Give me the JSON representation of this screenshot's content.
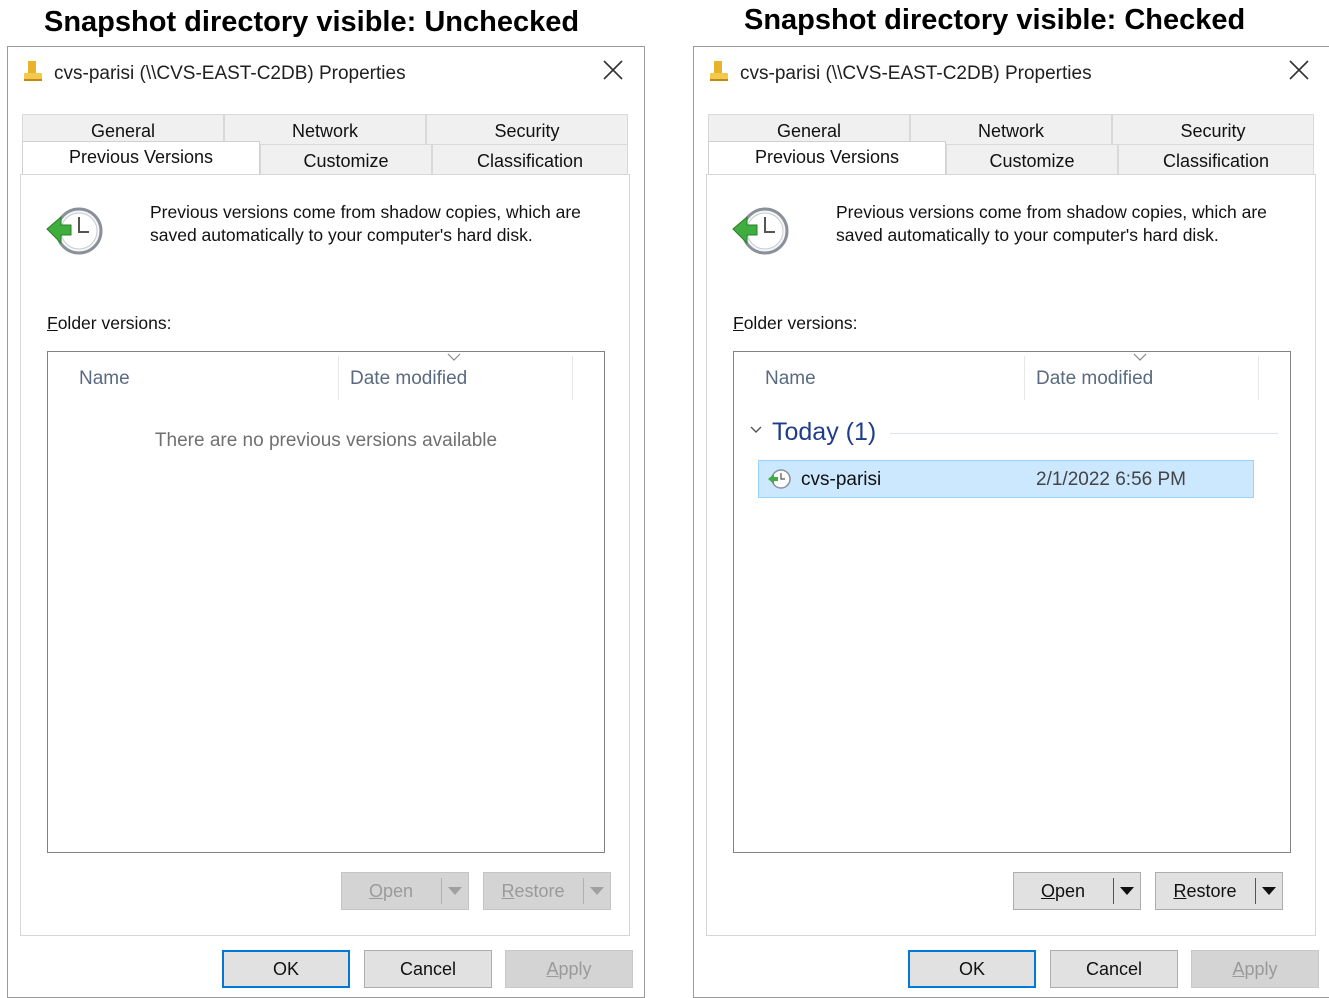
{
  "captions": {
    "left": "Snapshot directory visible: Unchecked",
    "right": "Snapshot directory visible: Checked"
  },
  "dialog": {
    "title": "cvs-parisi (\\\\CVS-EAST-C2DB) Properties",
    "tabs_row1": [
      "General",
      "Network",
      "Security"
    ],
    "tabs_row2": [
      "Previous Versions",
      "Customize",
      "Classification"
    ],
    "active_tab": "Previous Versions",
    "description_line1": "Previous versions come from shadow copies, which are",
    "description_line2": "saved automatically to your computer's hard disk.",
    "folder_versions_first": "F",
    "folder_versions_rest": "older versions:",
    "columns": {
      "name": "Name",
      "date": "Date modified"
    },
    "buttons": {
      "open_first": "O",
      "open_rest": "pen",
      "restore_first": "R",
      "restore_rest": "estore",
      "ok": "OK",
      "cancel": "Cancel",
      "apply_first": "A",
      "apply_rest": "pply"
    }
  },
  "left": {
    "empty_message": "There are no previous versions available",
    "open_enabled": false,
    "restore_enabled": false
  },
  "right": {
    "group_title": "Today (1)",
    "versions": [
      {
        "name": "cvs-parisi",
        "date": "2/1/2022 6:56 PM"
      }
    ],
    "open_enabled": true,
    "restore_enabled": true
  },
  "icons": {
    "folder": "folder-icon",
    "close": "close-icon",
    "clock": "previous-versions-clock-icon",
    "row": "version-clock-icon"
  },
  "colors": {
    "selection_bg": "#cce8ff",
    "selection_border": "#99d1ff",
    "focus_blue": "#0078d7",
    "group_title": "#1f3d8a"
  }
}
